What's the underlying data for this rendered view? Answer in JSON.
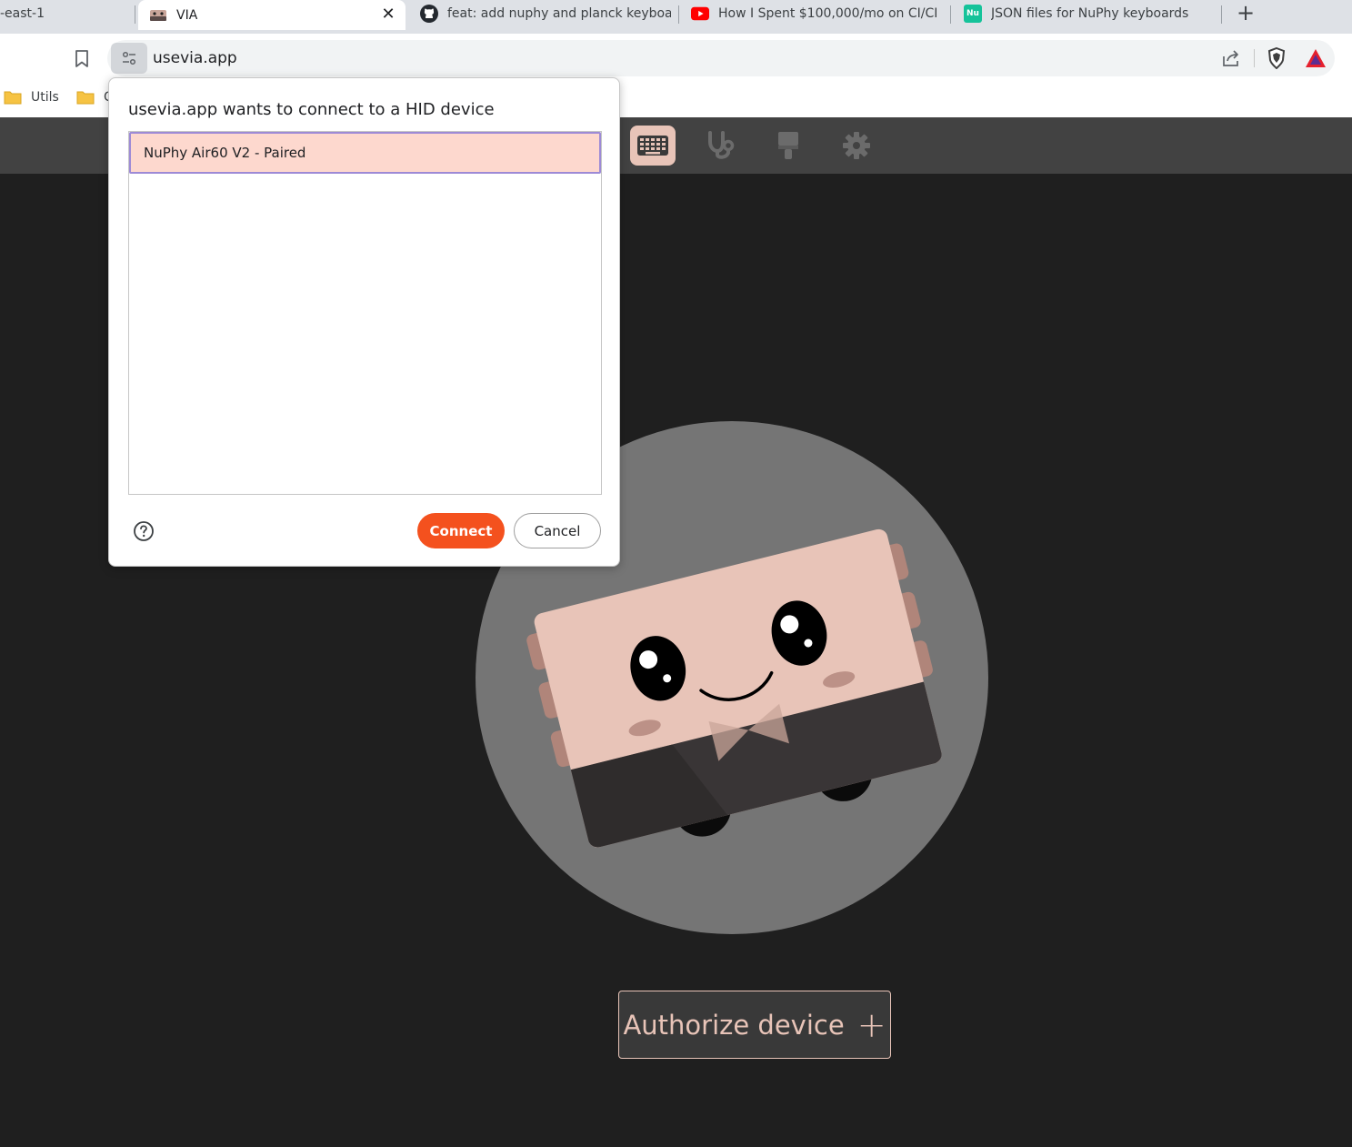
{
  "browser": {
    "tabs": [
      {
        "title": "-east-1",
        "favicon": "aws-icon",
        "active": false
      },
      {
        "title": "VIA",
        "favicon": "via-icon",
        "active": true
      },
      {
        "title": "feat: add nuphy and planck keyboard",
        "favicon": "github-icon",
        "active": false
      },
      {
        "title": "How I Spent $100,000/mo on CI/CD",
        "favicon": "youtube-icon",
        "active": false
      },
      {
        "title": "JSON files for NuPhy keyboards",
        "favicon": "nuphy-icon",
        "favicon_text": "Nu",
        "active": false
      }
    ],
    "close_glyph": "✕",
    "new_tab_glyph": "+",
    "url": "usevia.app",
    "bookmarks": [
      {
        "label": "Utils",
        "icon": "folder-icon"
      },
      {
        "label": "C",
        "icon": "folder-icon"
      }
    ]
  },
  "app": {
    "nav": [
      {
        "name": "configure",
        "icon": "keyboard-icon",
        "active": true
      },
      {
        "name": "test",
        "icon": "stethoscope-icon",
        "active": false
      },
      {
        "name": "design",
        "icon": "paint-brush-icon",
        "active": false
      },
      {
        "name": "settings",
        "icon": "gear-icon",
        "active": false
      }
    ],
    "authorize_label": "Authorize device",
    "authorize_glyph": "+",
    "colors": {
      "accent": "#e8c4b8",
      "header_bg": "#424242",
      "body_bg": "#1f1f1f",
      "connect_button": "#f4511e"
    }
  },
  "dialog": {
    "title": "usevia.app wants to connect to a HID device",
    "devices": [
      {
        "label": "NuPhy Air60 V2 - Paired",
        "selected": true
      }
    ],
    "connect_label": "Connect",
    "cancel_label": "Cancel"
  }
}
